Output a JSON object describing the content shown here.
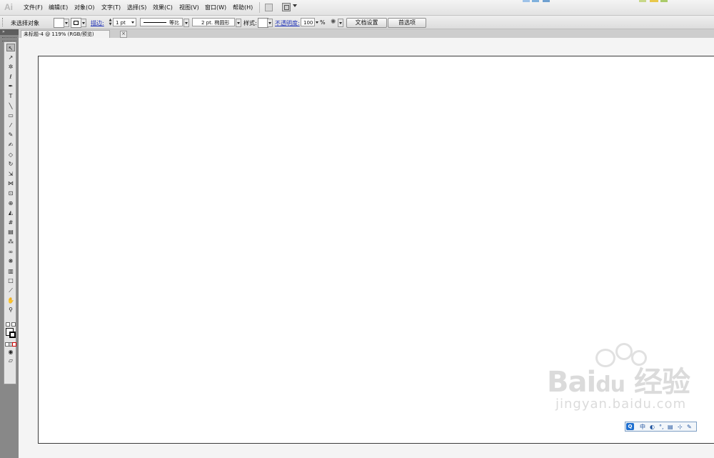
{
  "app": {
    "logo": "Ai"
  },
  "menu": {
    "items": [
      "文件(F)",
      "编辑(E)",
      "对象(O)",
      "文字(T)",
      "选择(S)",
      "效果(C)",
      "视图(V)",
      "窗口(W)",
      "帮助(H)"
    ]
  },
  "control_bar": {
    "selection_status": "未选择对象",
    "stroke_label": "描边:",
    "stroke_weight": "1 pt",
    "stroke_profile": "等比",
    "brush": "2 pt. 椭圆形",
    "style_label": "样式:",
    "opacity_label": "不透明度:",
    "opacity_value": "100",
    "opacity_unit": "%",
    "doc_setup_button": "文档设置",
    "preferences_button": "首选项"
  },
  "document": {
    "tab_title": "未标题-4 @ 119% (RGB/预览)",
    "close_glyph": "×"
  },
  "toolbox": {
    "collapse_glyph": "»",
    "tools": [
      {
        "name": "selection-tool",
        "glyph": "↖",
        "active": true
      },
      {
        "name": "direct-selection-tool",
        "glyph": "↗"
      },
      {
        "name": "magic-wand-tool",
        "glyph": "✲"
      },
      {
        "name": "lasso-tool",
        "glyph": "ℓ"
      },
      {
        "name": "pen-tool",
        "glyph": "✒"
      },
      {
        "name": "type-tool",
        "glyph": "T"
      },
      {
        "name": "line-segment-tool",
        "glyph": "╲"
      },
      {
        "name": "rectangle-tool",
        "glyph": "▭"
      },
      {
        "name": "paintbrush-tool",
        "glyph": "⁄"
      },
      {
        "name": "pencil-tool",
        "glyph": "✎"
      },
      {
        "name": "blob-brush-tool",
        "glyph": "✍"
      },
      {
        "name": "eraser-tool",
        "glyph": "◇"
      },
      {
        "name": "rotate-tool",
        "glyph": "↻"
      },
      {
        "name": "scale-tool",
        "glyph": "⇲"
      },
      {
        "name": "width-tool",
        "glyph": "⋈"
      },
      {
        "name": "free-transform-tool",
        "glyph": "⊡"
      },
      {
        "name": "shape-builder-tool",
        "glyph": "⊕"
      },
      {
        "name": "perspective-grid-tool",
        "glyph": "◭"
      },
      {
        "name": "mesh-tool",
        "glyph": "#"
      },
      {
        "name": "gradient-tool",
        "glyph": "▤"
      },
      {
        "name": "eyedropper-tool",
        "glyph": "⁂"
      },
      {
        "name": "blend-tool",
        "glyph": "∞"
      },
      {
        "name": "symbol-sprayer-tool",
        "glyph": "❋"
      },
      {
        "name": "column-graph-tool",
        "glyph": "▥"
      },
      {
        "name": "artboard-tool",
        "glyph": "□"
      },
      {
        "name": "slice-tool",
        "glyph": "⟋"
      },
      {
        "name": "hand-tool",
        "glyph": "✋"
      },
      {
        "name": "zoom-tool",
        "glyph": "⚲"
      }
    ],
    "draw_modes": [
      "◉",
      "▱"
    ]
  },
  "taskbar": {
    "ime_logo": "Q",
    "ime_chars": [
      "中",
      "◐",
      "°,",
      "▤",
      "⊹",
      "✎"
    ]
  },
  "colors": {
    "accent_link": "#2436b8",
    "artboard": "#ffffff",
    "canvas": "#f4f4f4",
    "toolbox": "#888888"
  }
}
